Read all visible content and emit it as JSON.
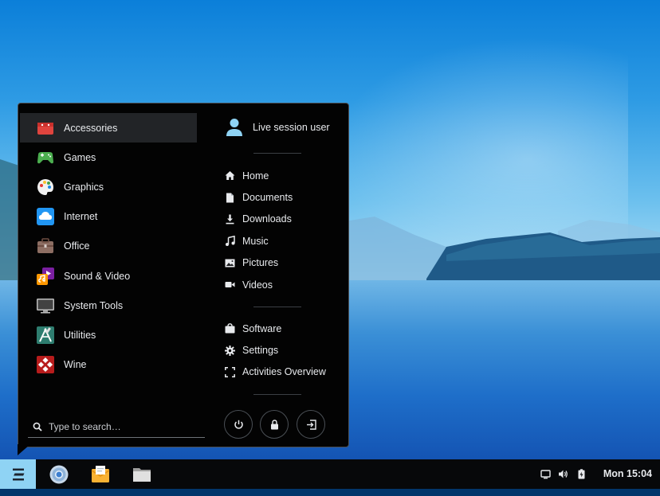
{
  "menu": {
    "categories": [
      {
        "label": "Accessories",
        "icon": "accessories-icon",
        "active": true
      },
      {
        "label": "Games",
        "icon": "games-icon"
      },
      {
        "label": "Graphics",
        "icon": "graphics-icon"
      },
      {
        "label": "Internet",
        "icon": "internet-icon"
      },
      {
        "label": "Office",
        "icon": "office-icon"
      },
      {
        "label": "Sound & Video",
        "icon": "sound-video-icon"
      },
      {
        "label": "System Tools",
        "icon": "system-tools-icon"
      },
      {
        "label": "Utilities",
        "icon": "utilities-icon"
      },
      {
        "label": "Wine",
        "icon": "wine-icon"
      }
    ],
    "search": {
      "placeholder": "Type to search…"
    },
    "user": {
      "name": "Live session user"
    },
    "places": [
      {
        "label": "Home",
        "icon": "home-icon"
      },
      {
        "label": "Documents",
        "icon": "document-icon"
      },
      {
        "label": "Downloads",
        "icon": "download-icon"
      },
      {
        "label": "Music",
        "icon": "music-icon"
      },
      {
        "label": "Pictures",
        "icon": "picture-icon"
      },
      {
        "label": "Videos",
        "icon": "video-icon"
      }
    ],
    "system": [
      {
        "label": "Software",
        "icon": "software-icon"
      },
      {
        "label": "Settings",
        "icon": "gear-icon"
      },
      {
        "label": "Activities Overview",
        "icon": "activities-icon"
      }
    ],
    "actions": [
      {
        "name": "power",
        "icon": "power-icon"
      },
      {
        "name": "lock",
        "icon": "lock-icon"
      },
      {
        "name": "logout",
        "icon": "logout-icon"
      }
    ]
  },
  "taskbar": {
    "start_icon": "zorin-logo-icon",
    "apps": [
      {
        "name": "chromium",
        "icon": "browser-icon"
      },
      {
        "name": "mail",
        "icon": "mail-icon"
      },
      {
        "name": "files",
        "icon": "files-icon"
      }
    ],
    "tray": [
      {
        "name": "display",
        "icon": "display-icon"
      },
      {
        "name": "volume",
        "icon": "volume-icon"
      },
      {
        "name": "battery",
        "icon": "battery-icon"
      }
    ],
    "clock": "Mon 15:04"
  },
  "colors": {
    "menu_bg": "#030303",
    "active_item": "#222427",
    "start_button": "#8fd3f4",
    "taskbar_bg": "#07080a"
  }
}
